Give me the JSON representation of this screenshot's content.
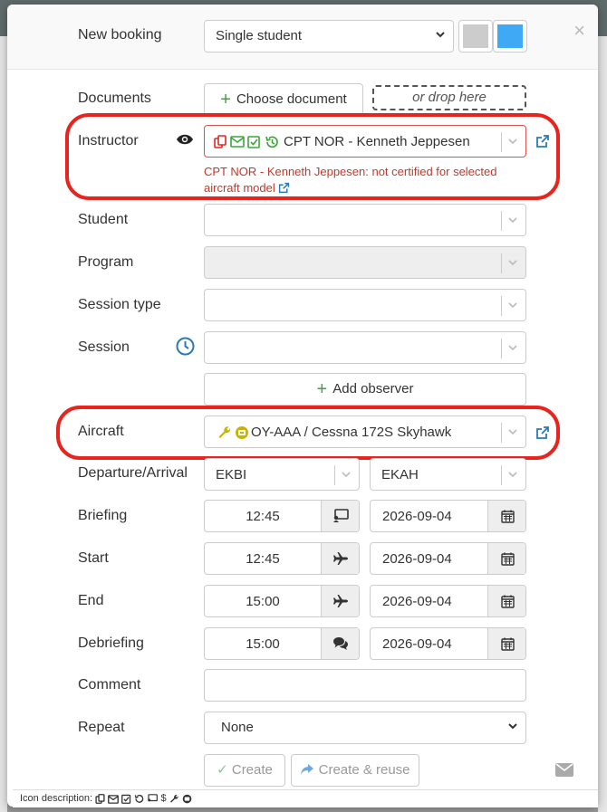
{
  "header": {
    "title": "New booking",
    "booking_type": "Single student",
    "color_primary": "#cccccc",
    "color_secondary": "#3fa9f5",
    "close": "×"
  },
  "documents": {
    "label": "Documents",
    "choose_button": "Choose document",
    "drop_hint": "or drop here"
  },
  "instructor": {
    "label": "Instructor",
    "value": "CPT NOR - Kenneth Jeppesen",
    "warning_line1": "CPT NOR - Kenneth Jeppesen: not certified for selected",
    "warning_line2": "aircraft model",
    "icons": [
      "copy-icon",
      "envelope-icon",
      "checkbox-icon",
      "history-icon"
    ],
    "icon_colors": {
      "red": "#e8241e",
      "green": "#3aa63a"
    }
  },
  "student": {
    "label": "Student",
    "value": ""
  },
  "program": {
    "label": "Program",
    "value": ""
  },
  "session_type": {
    "label": "Session type",
    "value": ""
  },
  "session": {
    "label": "Session",
    "value": ""
  },
  "observer": {
    "add_button": "Add observer"
  },
  "aircraft": {
    "label": "Aircraft",
    "value": "OY-AAA / Cessna 172S Skyhawk",
    "icons": [
      "wrench-icon",
      "engine-icon"
    ],
    "icon_color": "#c8b400"
  },
  "departure_arrival": {
    "label": "Departure/Arrival",
    "departure": "EKBI",
    "arrival": "EKAH"
  },
  "briefing": {
    "label": "Briefing",
    "time": "12:45",
    "date": "2026-09-04"
  },
  "start": {
    "label": "Start",
    "time": "12:45",
    "date": "2026-09-04"
  },
  "end": {
    "label": "End",
    "time": "15:00",
    "date": "2026-09-04"
  },
  "debriefing": {
    "label": "Debriefing",
    "time": "15:00",
    "date": "2026-09-04"
  },
  "comment": {
    "label": "Comment",
    "value": ""
  },
  "repeat": {
    "label": "Repeat",
    "value": "None"
  },
  "actions": {
    "create": "Create",
    "create_reuse": "Create & reuse"
  },
  "footer": {
    "icon_description_label": "Icon description:"
  },
  "highlight_color": "#e8241e"
}
